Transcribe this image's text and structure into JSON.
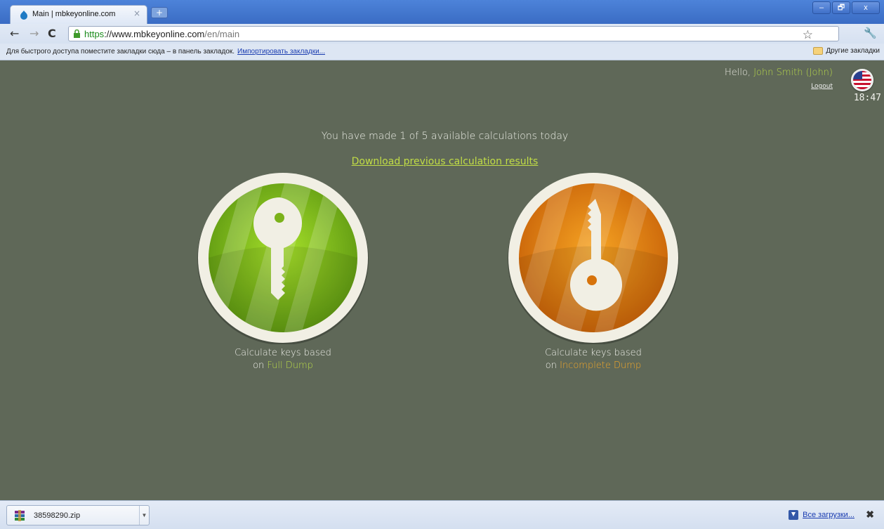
{
  "browser": {
    "tab_title": "Main | mbkeyonline.com",
    "tab_close": "×",
    "new_tab": "+",
    "window_controls": {
      "minimize": "–",
      "restore": "🗗",
      "close": "x"
    },
    "url_https": "https",
    "url_sep": "://",
    "url_host": "www.mbkeyonline.com",
    "url_path": "/en/main",
    "bookmarks_hint": "Для быстрого доступа поместите закладки сюда – в панель закладок.",
    "bookmarks_import": "Импортировать закладки...",
    "other_bookmarks": "Другие закладки"
  },
  "header": {
    "hello_prefix": "Hello, ",
    "user_name": "John Smith (John)",
    "logout": "Logout",
    "time": "18:47",
    "flag_icon": "us-flag-icon"
  },
  "main": {
    "calc_info": "You have made 1 of 5 available calculations today",
    "download_link": "Download previous calculation results",
    "green": {
      "caption_line1": "Calculate keys based",
      "caption_on": "on ",
      "caption_highlight": "Full Dump",
      "color": "#8cc81e"
    },
    "orange": {
      "caption_line1": "Calculate keys based",
      "caption_on": "on ",
      "caption_highlight": "Incomplete Dump",
      "color": "#f08c12"
    }
  },
  "downloads": {
    "file_name": "38598290.zip",
    "all_downloads": "Все загрузки...",
    "close": "✖"
  }
}
